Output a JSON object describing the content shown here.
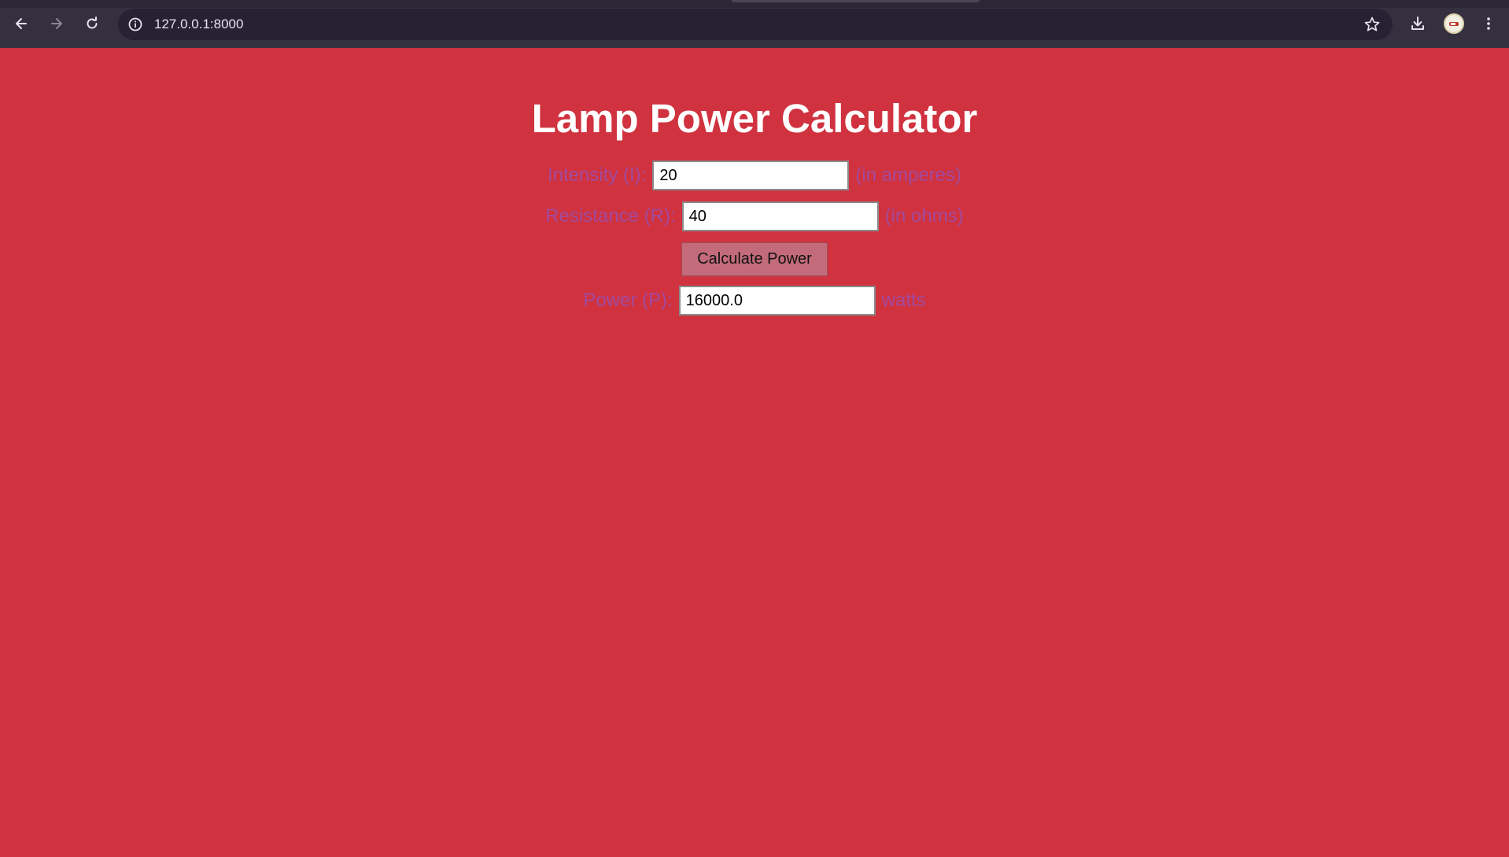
{
  "browser": {
    "url": "127.0.0.1:8000",
    "icons": [
      "back-arrow-icon",
      "forward-arrow-icon",
      "reload-icon",
      "site-info-icon",
      "bookmark-star-icon",
      "download-icon",
      "profile-avatar",
      "more-menu-icon"
    ]
  },
  "page": {
    "title": "Lamp Power Calculator",
    "background_color": "#d0323f",
    "label_color": "#a24a9e",
    "intensity": {
      "label": "Intensity (I):",
      "value": "20",
      "unit": "(in amperes)"
    },
    "resistance": {
      "label": "Resistance (R):",
      "value": "40",
      "unit": "(in ohms)"
    },
    "calculate_button": "Calculate Power",
    "power": {
      "label": "Power (P):",
      "value": "16000.0",
      "unit": "watts"
    }
  }
}
